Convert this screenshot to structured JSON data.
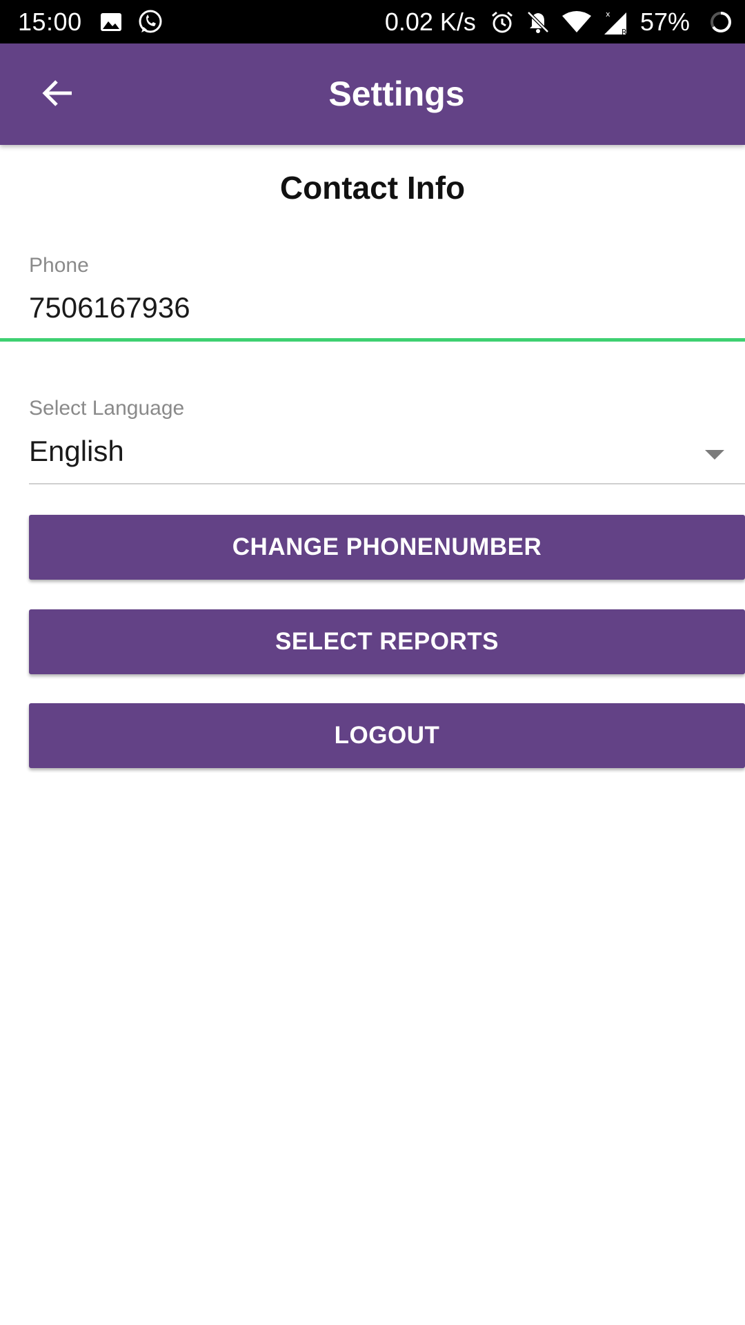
{
  "status_bar": {
    "time": "15:00",
    "network_speed": "0.02 K/s",
    "battery": "57%",
    "left_icons": [
      "image-icon",
      "whatsapp-icon"
    ],
    "right_icons": [
      "alarm-icon",
      "bell-off-icon",
      "wifi-icon",
      "signal-icon",
      "battery-icon"
    ]
  },
  "app_bar": {
    "title": "Settings",
    "back_icon": "arrow-back-icon",
    "color": "#634286"
  },
  "content": {
    "section_title": "Contact Info",
    "phone": {
      "label": "Phone",
      "value": "7506167936",
      "underline_color": "#3ed071"
    },
    "language": {
      "label": "Select Language",
      "selected": "English"
    },
    "buttons": {
      "change_phone": "CHANGE PHONENUMBER",
      "select_reports": "SELECT REPORTS",
      "logout": "LOGOUT"
    }
  }
}
